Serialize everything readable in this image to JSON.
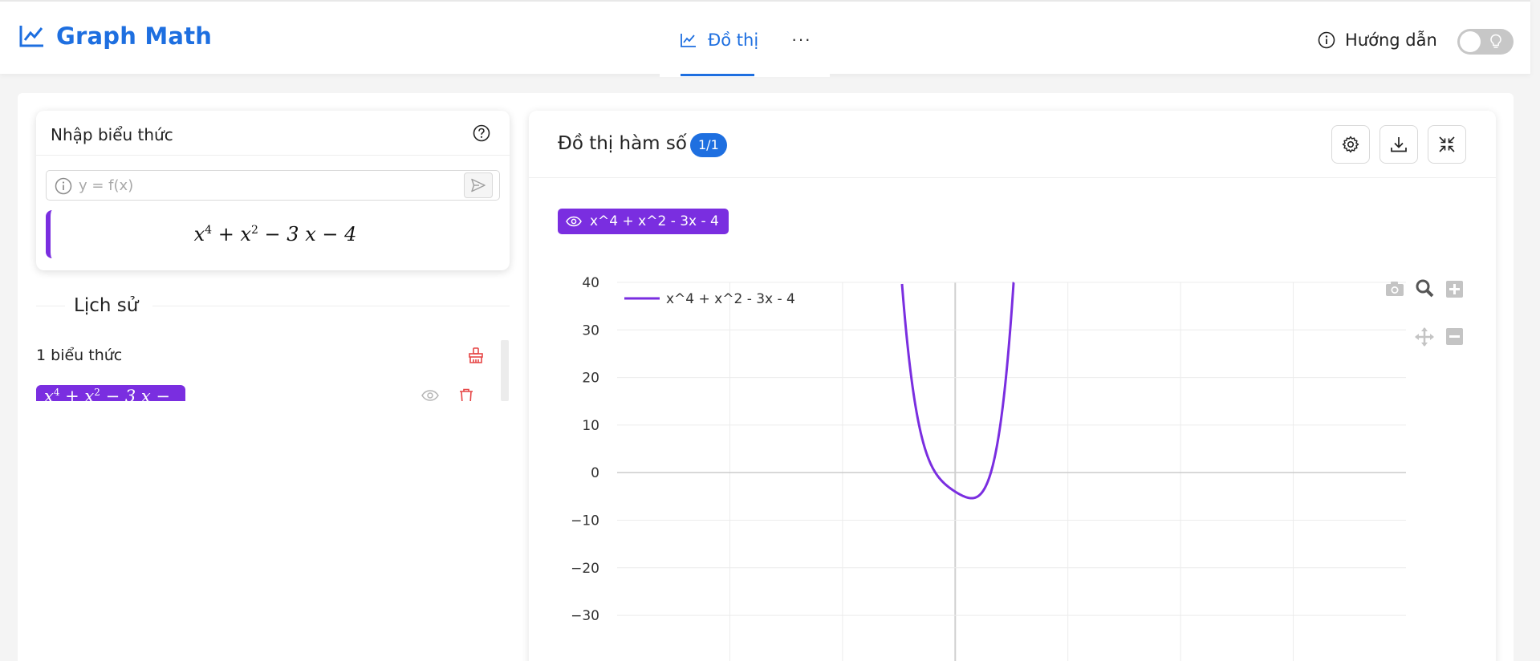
{
  "header": {
    "app_title": "Graph Math",
    "tab_graph_label": "Đồ thị",
    "more_label": "···",
    "guide_label": "Hướng dẫn",
    "theme_toggle_on": false
  },
  "input_panel": {
    "title": "Nhập biểu thức",
    "input_placeholder": "y = f(x)",
    "input_value": ""
  },
  "history": {
    "title": "Lịch sử",
    "count_label": "1 biểu thức"
  },
  "graph_panel": {
    "title": "Đồ thị hàm số",
    "page_badge": "1/1",
    "series_tag_label": "x^4 + x^2 - 3x - 4"
  },
  "colors": {
    "accent": "#1e6fe0",
    "series": "#7a2ee0",
    "danger": "#e64545"
  },
  "icons": {
    "logo": "line-chart-icon",
    "tab": "line-chart-icon",
    "guide": "info-circle-icon",
    "toggle": "lightbulb-icon",
    "help": "question-circle-icon",
    "input_info": "info-circle-icon",
    "send": "send-icon",
    "clear_history": "broom-icon",
    "history_visibility": "eye-icon",
    "history_delete": "trash-icon",
    "settings": "gear-icon",
    "download": "download-icon",
    "fullscreen": "fullscreen-icon",
    "series_visibility": "eye-icon",
    "modebar": [
      "camera-icon",
      "zoom-icon",
      "zoom-in-icon",
      "pan-icon",
      "zoom-out-icon"
    ]
  },
  "chart_data": {
    "type": "line",
    "series": [
      {
        "name": "x^4 + x^2 - 3x - 4",
        "expression": "x^4 + x^2 - 3x - 4",
        "color": "#7a2ee0"
      }
    ],
    "y_ticks": [
      40,
      30,
      20,
      10,
      0,
      -10,
      -20,
      -30
    ],
    "y_tick_labels": [
      "40",
      "30",
      "20",
      "10",
      "0",
      "−10",
      "−20",
      "−30"
    ],
    "ylim": [
      -39.6,
      40
    ],
    "xlim": [
      -15,
      20
    ],
    "x_gridlines": [
      -10,
      -5,
      0,
      5,
      10,
      15
    ],
    "grid": true,
    "legend_position": "top-left"
  }
}
